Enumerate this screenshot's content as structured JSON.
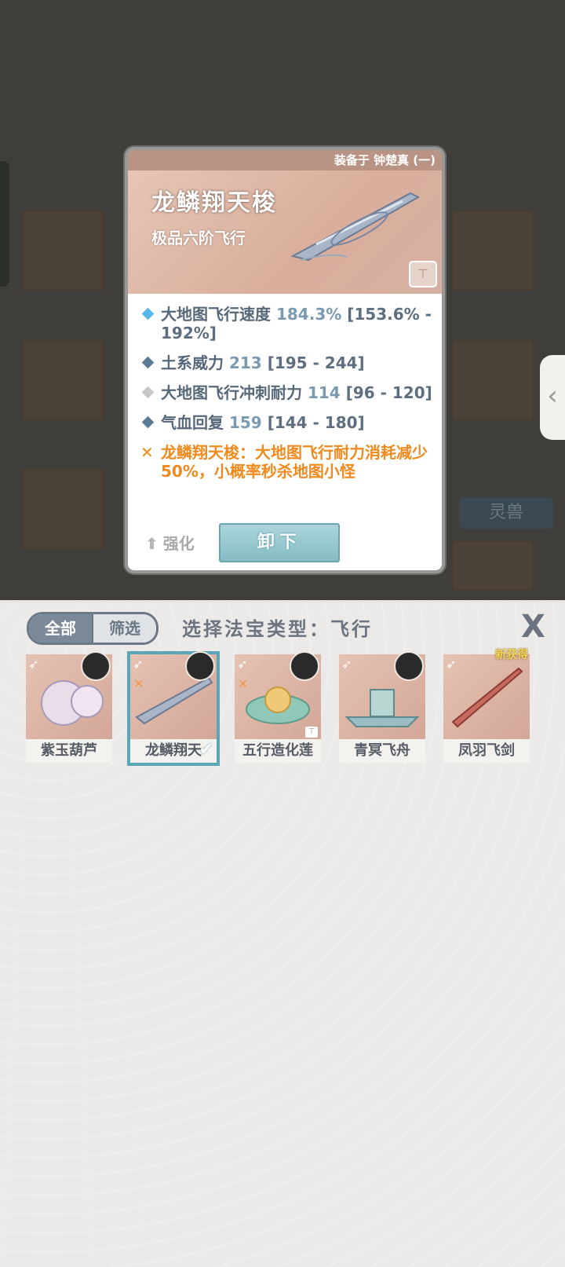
{
  "detail": {
    "equipped_text": "装备于 钟楚真 (一)",
    "title": "龙鳞翔天梭",
    "grade": "极品六阶飞行",
    "stats": [
      {
        "name": "大地图飞行速度",
        "value": "184.3%",
        "range": "[153.6% - 192%]",
        "diamond_color": "#58b7e6"
      },
      {
        "name": "土系威力",
        "value": "213",
        "range": "[195 - 244]",
        "diamond_color": "#5b7a94"
      },
      {
        "name": "大地图飞行冲刺耐力",
        "value": "114",
        "range": "[96 - 120]",
        "diamond_color": "#c6c6c6"
      },
      {
        "name": "气血回复",
        "value": "159",
        "range": "[144 - 180]",
        "diamond_color": "#5b7a94"
      }
    ],
    "special_text": "龙鳞翔天梭：大地图飞行耐力消耗减少50%，小概率秒杀地图小怪",
    "enhance_label": "强化",
    "unload_label": "卸下"
  },
  "background": {
    "side_label": "灵兽"
  },
  "panel": {
    "tab_all": "全部",
    "tab_filter": "筛选",
    "title": "选择法宝类型：飞行",
    "close_label": "X",
    "items": [
      {
        "name": "紫玉葫芦",
        "selected": false,
        "new": false
      },
      {
        "name": "龙鳞翔天",
        "selected": true,
        "new": false
      },
      {
        "name": "五行造化莲",
        "selected": false,
        "new": false
      },
      {
        "name": "青冥飞舟",
        "selected": false,
        "new": false
      },
      {
        "name": "凤羽飞剑",
        "selected": false,
        "new": true
      }
    ],
    "new_tag": "新获得"
  },
  "icons": {
    "wing": "wing-icon",
    "check": "check-icon",
    "lock": "lock-icon",
    "up-arrow": "up-arrow-icon",
    "left-chevron": "chevron-left-icon"
  },
  "colors": {
    "accent_teal": "#5aa6b6",
    "special_orange": "#f08a1e",
    "stat_value_blue": "#7a9ab2"
  }
}
